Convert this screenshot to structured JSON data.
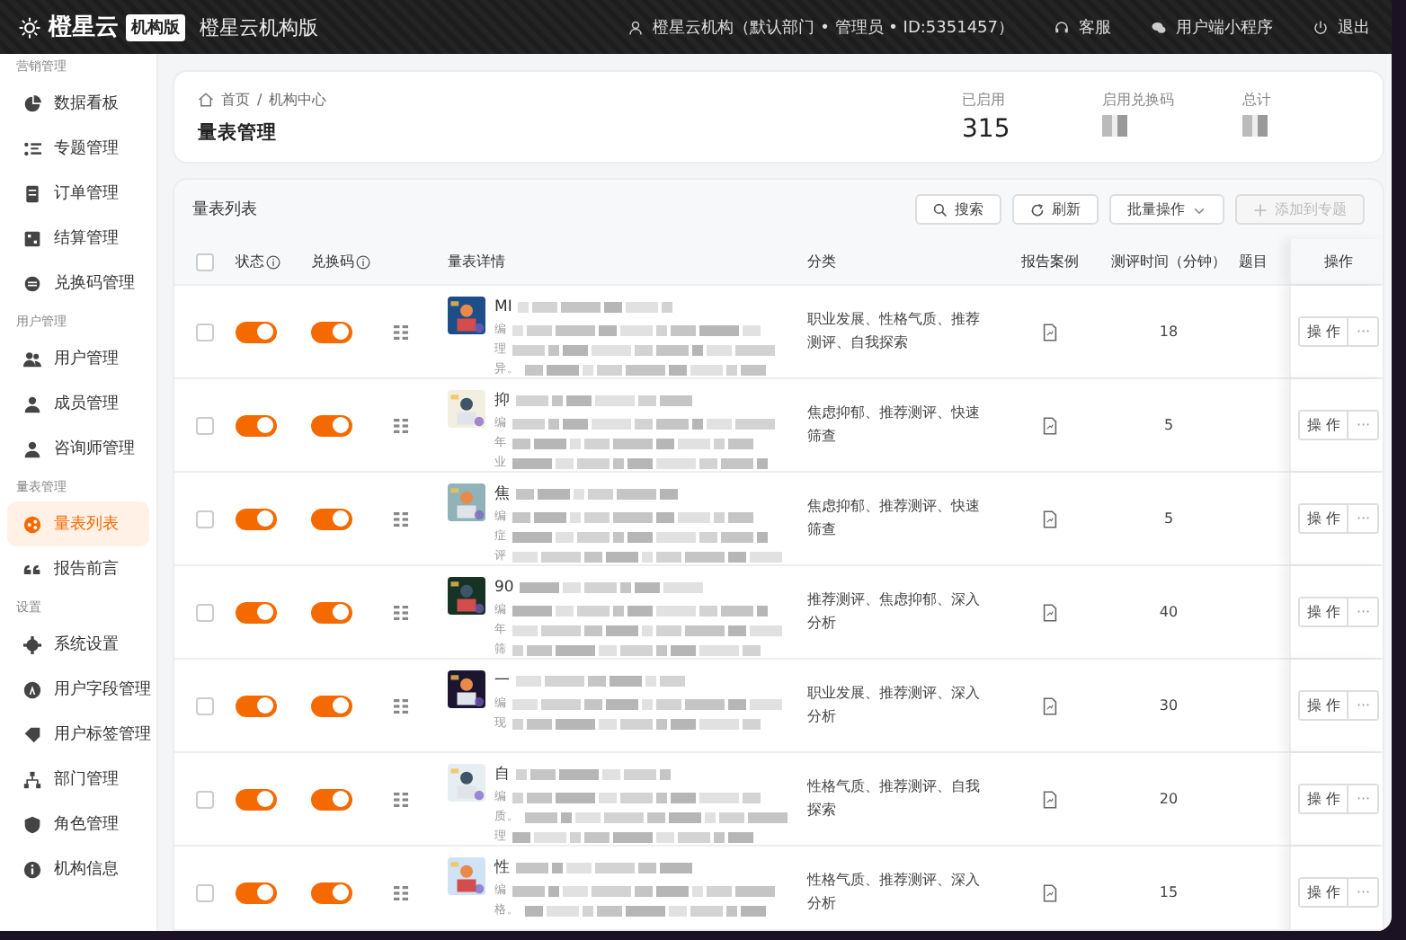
{
  "topbar": {
    "logo": "橙星云",
    "edition_badge": "机构版",
    "product": "橙星云机构版",
    "account": "橙星云机构（默认部门 • 管理员 • ID:5351457）",
    "links": [
      {
        "kind": "support",
        "label": "客服"
      },
      {
        "kind": "miniapp",
        "label": "用户端小程序"
      },
      {
        "kind": "logout",
        "label": "退出"
      }
    ]
  },
  "sidebar": {
    "groups": [
      {
        "title": "营销管理",
        "items": [
          {
            "label": "数据看板",
            "selected": false
          },
          {
            "label": "专题管理",
            "selected": false
          },
          {
            "label": "订单管理",
            "selected": false
          },
          {
            "label": "结算管理",
            "selected": false
          },
          {
            "label": "兑换码管理",
            "selected": false
          }
        ]
      },
      {
        "title": "用户管理",
        "items": [
          {
            "label": "用户管理",
            "selected": false
          },
          {
            "label": "成员管理",
            "selected": false
          },
          {
            "label": "咨询师管理",
            "selected": false
          }
        ]
      },
      {
        "title": "量表管理",
        "items": [
          {
            "label": "量表列表",
            "selected": true
          },
          {
            "label": "报告前言",
            "selected": false
          }
        ]
      },
      {
        "title": "设置",
        "items": [
          {
            "label": "系统设置",
            "selected": false
          },
          {
            "label": "用户字段管理",
            "selected": false
          },
          {
            "label": "用户标签管理",
            "selected": false
          },
          {
            "label": "部门管理",
            "selected": false
          },
          {
            "label": "角色管理",
            "selected": false
          },
          {
            "label": "机构信息",
            "selected": false
          }
        ]
      }
    ]
  },
  "page_header": {
    "breadcrumb": [
      "首页",
      "机构中心"
    ],
    "breadcrumb_separator": "/",
    "title": "量表管理",
    "stats": [
      {
        "label": "已启用",
        "value": "315"
      },
      {
        "label": "启用兑换码"
      },
      {
        "label": "总计"
      }
    ]
  },
  "table_card": {
    "title": "量表列表",
    "buttons": [
      {
        "kind": "search",
        "label": "搜索",
        "disabled": false
      },
      {
        "kind": "refresh",
        "label": "刷新",
        "disabled": false
      },
      {
        "kind": "dropdown",
        "label": "批量操作",
        "disabled": false
      },
      {
        "kind": "add",
        "label": "添加到专题",
        "disabled": true
      }
    ],
    "select_all_checked": false,
    "columns": [
      "状态",
      "兑换码",
      "量表详情",
      "分类",
      "报告案例",
      "测评时间（分钟）",
      "题目",
      "操作"
    ],
    "rows": [
      {
        "checked": false,
        "status_on": true,
        "code_on": true,
        "title": "MI",
        "desc_lines": [
          "编",
          "理",
          "异。"
        ],
        "category": "职业发展、性格气质、推荐测评、自我探索",
        "minutes": "18",
        "action": "操 作",
        "more": "···"
      },
      {
        "checked": false,
        "status_on": true,
        "code_on": true,
        "title": "抑",
        "desc_lines": [
          "编",
          "年",
          "业"
        ],
        "category": "焦虑抑郁、推荐测评、快速筛查",
        "minutes": "5",
        "action": "操 作",
        "more": "···"
      },
      {
        "checked": false,
        "status_on": true,
        "code_on": true,
        "title": "焦",
        "desc_lines": [
          "编",
          "症",
          "评"
        ],
        "category": "焦虑抑郁、推荐测评、快速筛查",
        "minutes": "5",
        "action": "操 作",
        "more": "···"
      },
      {
        "checked": false,
        "status_on": true,
        "code_on": true,
        "title": "90",
        "desc_lines": [
          "编",
          "年",
          "筛"
        ],
        "category": "推荐测评、焦虑抑郁、深入分析",
        "minutes": "40",
        "action": "操 作",
        "more": "···"
      },
      {
        "checked": false,
        "status_on": true,
        "code_on": true,
        "title": "一",
        "desc_lines": [
          "编",
          "现"
        ],
        "category": "职业发展、推荐测评、深入分析",
        "minutes": "30",
        "action": "操 作",
        "more": "···"
      },
      {
        "checked": false,
        "status_on": true,
        "code_on": true,
        "title": "自",
        "desc_lines": [
          "编",
          "质。",
          "理"
        ],
        "category": "性格气质、推荐测评、自我探索",
        "minutes": "20",
        "action": "操 作",
        "more": "···"
      },
      {
        "checked": false,
        "status_on": true,
        "code_on": true,
        "title": "性",
        "desc_lines": [
          "编",
          "格。"
        ],
        "category": "性格气质、推荐测评、深入分析",
        "minutes": "15",
        "action": "操 作",
        "more": "···"
      }
    ]
  }
}
